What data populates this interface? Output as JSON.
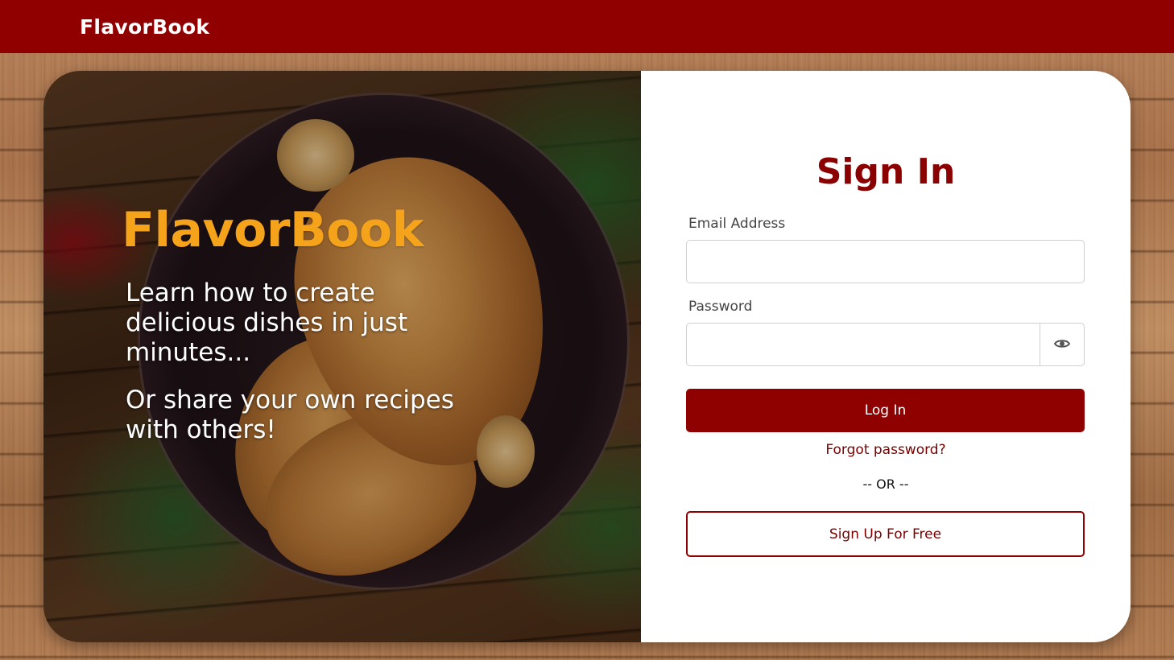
{
  "navbar": {
    "brand": "FlavorBook"
  },
  "hero": {
    "title": "FlavorBook",
    "line1": "Learn how to create delicious dishes in just minutes...",
    "line2": "Or share your own recipes with others!"
  },
  "signin": {
    "title": "Sign In",
    "email_label": "Email Address",
    "email_value": "",
    "password_label": "Password",
    "password_value": "",
    "login_label": "Log In",
    "forgot_label": "Forgot password?",
    "or_label": "-- OR --",
    "signup_label": "Sign Up For Free"
  },
  "colors": {
    "brand_red": "#900000",
    "accent_orange": "#f5a31a",
    "title_red": "#8b0000"
  },
  "icons": {
    "password_toggle": "eye-icon"
  }
}
